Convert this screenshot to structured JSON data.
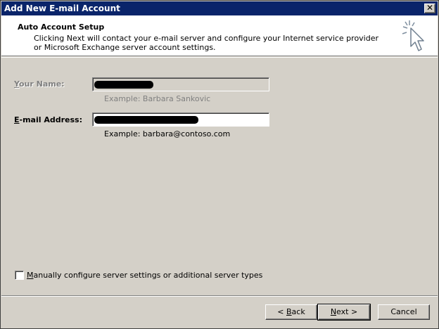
{
  "window": {
    "title": "Add New E-mail Account",
    "close_glyph": "✕"
  },
  "header": {
    "title": "Auto Account Setup",
    "description": "Clicking Next will contact your e-mail server and configure your Internet service provider or Microsoft Exchange server account settings.",
    "icon": "wizard-cursor-sparkle-icon"
  },
  "form": {
    "name": {
      "label_mnemonic": "Y",
      "label_rest": "our Name:",
      "value": "[redacted]",
      "example": "Example: Barbara Sankovic",
      "enabled": false
    },
    "email": {
      "label_mnemonic": "E",
      "label_rest": "-mail Address:",
      "value": "[redacted]",
      "example": "Example: barbara@contoso.com",
      "enabled": true
    }
  },
  "manual_config": {
    "label_mnemonic": "M",
    "label_rest": "anually configure server settings or additional server types",
    "checked": false
  },
  "buttons": {
    "back_prefix": "< ",
    "back_mnemonic": "B",
    "back_rest": "ack",
    "next_mnemonic": "N",
    "next_rest": "ext >",
    "cancel": "Cancel"
  },
  "colors": {
    "titlebar": "#0a246a",
    "dialog_face": "#d4d0c8",
    "disabled_text": "#808080"
  }
}
